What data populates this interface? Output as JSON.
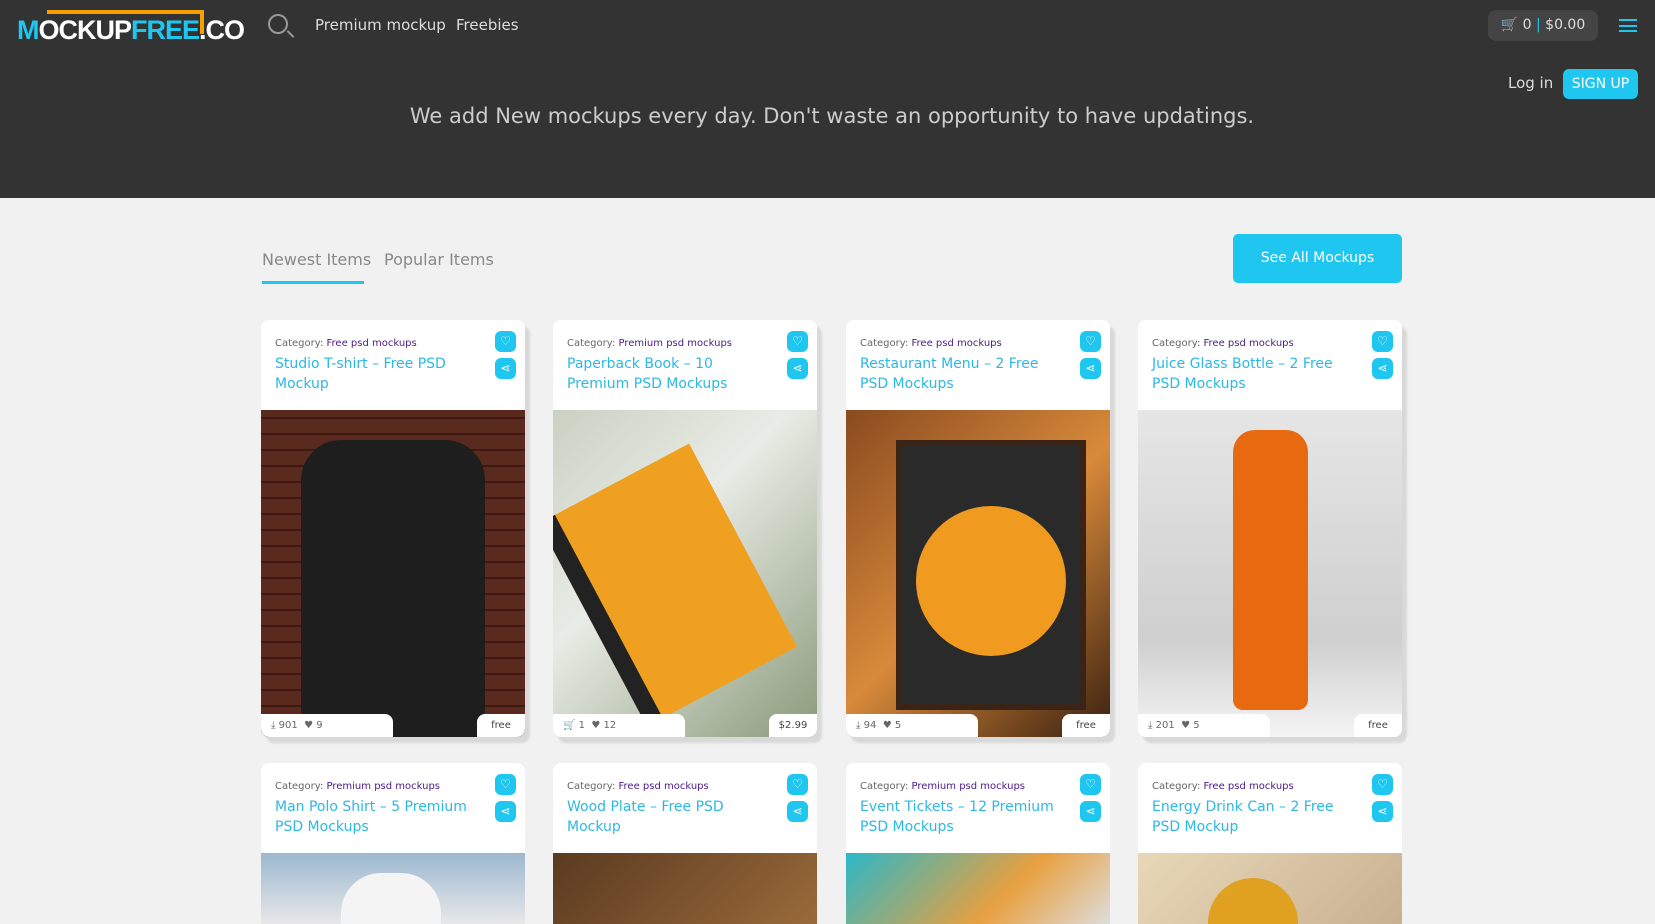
{
  "header": {
    "logo_text": "MOCKUPFREE.CO",
    "nav": [
      "Premium mockup",
      "Freebies"
    ],
    "cart_count": "0",
    "cart_total": "$0.00",
    "login": "Log in",
    "signup": "SIGN UP",
    "tagline": "We add New mockups every day. Don't waste an opportunity to have updatings.",
    "accent": "#1fc6ef"
  },
  "tabs": [
    {
      "label": "Newest Items",
      "active": true
    },
    {
      "label": "Popular Items",
      "active": false
    }
  ],
  "see_all": "See All Mockups",
  "category_label": "Category:",
  "cards": [
    {
      "category": "Free psd mockups",
      "title": "Studio T-shirt – Free PSD Mockup",
      "stat_icon": "download-icon",
      "count": "901",
      "likes": "9",
      "price": "free"
    },
    {
      "category": "Premium psd mockups",
      "title": "Paperback Book – 10 Premium PSD Mockups",
      "stat_icon": "cart-icon",
      "count": "1",
      "likes": "12",
      "price": "$2.99"
    },
    {
      "category": "Free psd mockups",
      "title": "Restaurant Menu – 2 Free PSD Mockups",
      "stat_icon": "download-icon",
      "count": "94",
      "likes": "5",
      "price": "free"
    },
    {
      "category": "Free psd mockups",
      "title": "Juice Glass Bottle – 2 Free PSD Mockups",
      "stat_icon": "download-icon",
      "count": "201",
      "likes": "5",
      "price": "free"
    },
    {
      "category": "Premium psd mockups",
      "title": "Man Polo Shirt – 5 Premium PSD Mockups"
    },
    {
      "category": "Free psd mockups",
      "title": "Wood Plate – Free PSD Mockup"
    },
    {
      "category": "Premium psd mockups",
      "title": "Event Tickets – 12 Premium PSD Mockups"
    },
    {
      "category": "Free psd mockups",
      "title": "Energy Drink Can – 2 Free PSD Mockup"
    }
  ]
}
